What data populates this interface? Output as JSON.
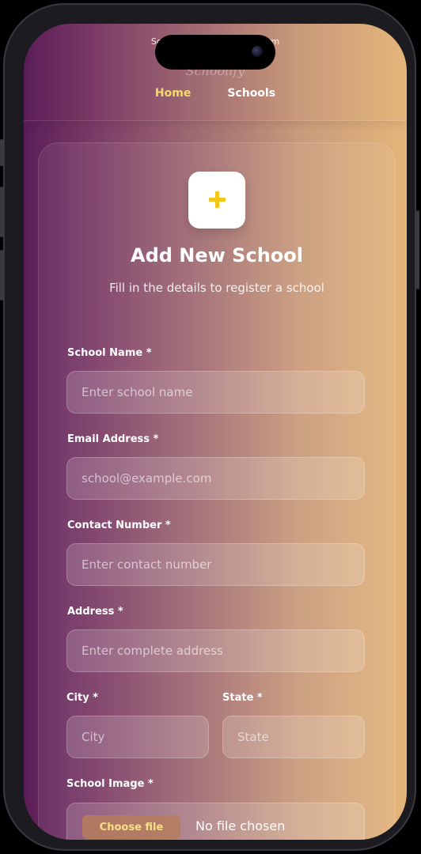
{
  "header": {
    "brand": "School Management Platform",
    "logo_text": "Schoolify",
    "nav": [
      {
        "label": "Home",
        "active": true
      },
      {
        "label": "Schools",
        "active": false
      }
    ]
  },
  "form": {
    "title": "Add New School",
    "subtitle": "Fill in the details to register a school",
    "fields": {
      "school_name": {
        "label": "School Name *",
        "placeholder": "Enter school name",
        "value": ""
      },
      "email": {
        "label": "Email Address *",
        "placeholder": "school@example.com",
        "value": ""
      },
      "contact": {
        "label": "Contact Number *",
        "placeholder": "Enter contact number",
        "value": ""
      },
      "address": {
        "label": "Address *",
        "placeholder": "Enter complete address",
        "value": ""
      },
      "city": {
        "label": "City *",
        "placeholder": "City",
        "value": ""
      },
      "state": {
        "label": "State *",
        "placeholder": "State",
        "value": ""
      },
      "image": {
        "label": "School Image *",
        "button": "Choose file",
        "status": "No file chosen"
      }
    }
  },
  "colors": {
    "accent": "#f5c518",
    "nav_active": "#f6d86b",
    "gradient_start": "#5a1d58",
    "gradient_end": "#e4b57a"
  },
  "icons": {
    "header_icon": "plus-icon"
  }
}
